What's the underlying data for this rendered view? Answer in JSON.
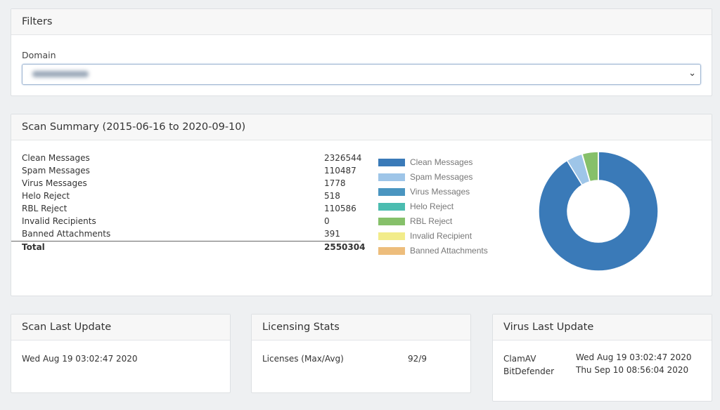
{
  "filters": {
    "title": "Filters",
    "domain_label": "Domain",
    "domain_value": ""
  },
  "summary": {
    "title": "Scan Summary (2015-06-16 to 2020-09-10)",
    "rows": [
      {
        "name": "Clean Messages",
        "value": "2326544"
      },
      {
        "name": "Spam Messages",
        "value": "110487"
      },
      {
        "name": "Virus Messages",
        "value": "1778"
      },
      {
        "name": "Helo Reject",
        "value": "518"
      },
      {
        "name": "RBL Reject",
        "value": "110586"
      },
      {
        "name": "Invalid Recipients",
        "value": "0"
      },
      {
        "name": "Banned Attachments",
        "value": "391"
      }
    ],
    "total": {
      "name": "Total",
      "value": "2550304"
    }
  },
  "chart_data": {
    "type": "pie",
    "donut": true,
    "legend": "left",
    "categories": [
      "Clean Messages",
      "Spam Messages",
      "Virus Messages",
      "Helo Reject",
      "RBL Reject",
      "Invalid Recipient",
      "Banned Attachments"
    ],
    "values": [
      2326544,
      110487,
      1778,
      518,
      110586,
      0,
      391
    ],
    "colors": [
      "#3a7ab8",
      "#9ec5e8",
      "#4a95c0",
      "#4bbcb0",
      "#86c06a",
      "#f2ec8a",
      "#edbd7c"
    ]
  },
  "scan_update": {
    "title": "Scan Last Update",
    "value": "Wed Aug 19 03:02:47 2020"
  },
  "licensing": {
    "title": "Licensing Stats",
    "label": "Licenses (Max/Avg)",
    "value": "92/9"
  },
  "virus_update": {
    "title": "Virus Last Update",
    "rows": [
      {
        "name": "ClamAV",
        "value": "Wed Aug 19 03:02:47 2020"
      },
      {
        "name": "BitDefender",
        "value": "Thu Sep 10 08:56:04 2020"
      }
    ]
  }
}
